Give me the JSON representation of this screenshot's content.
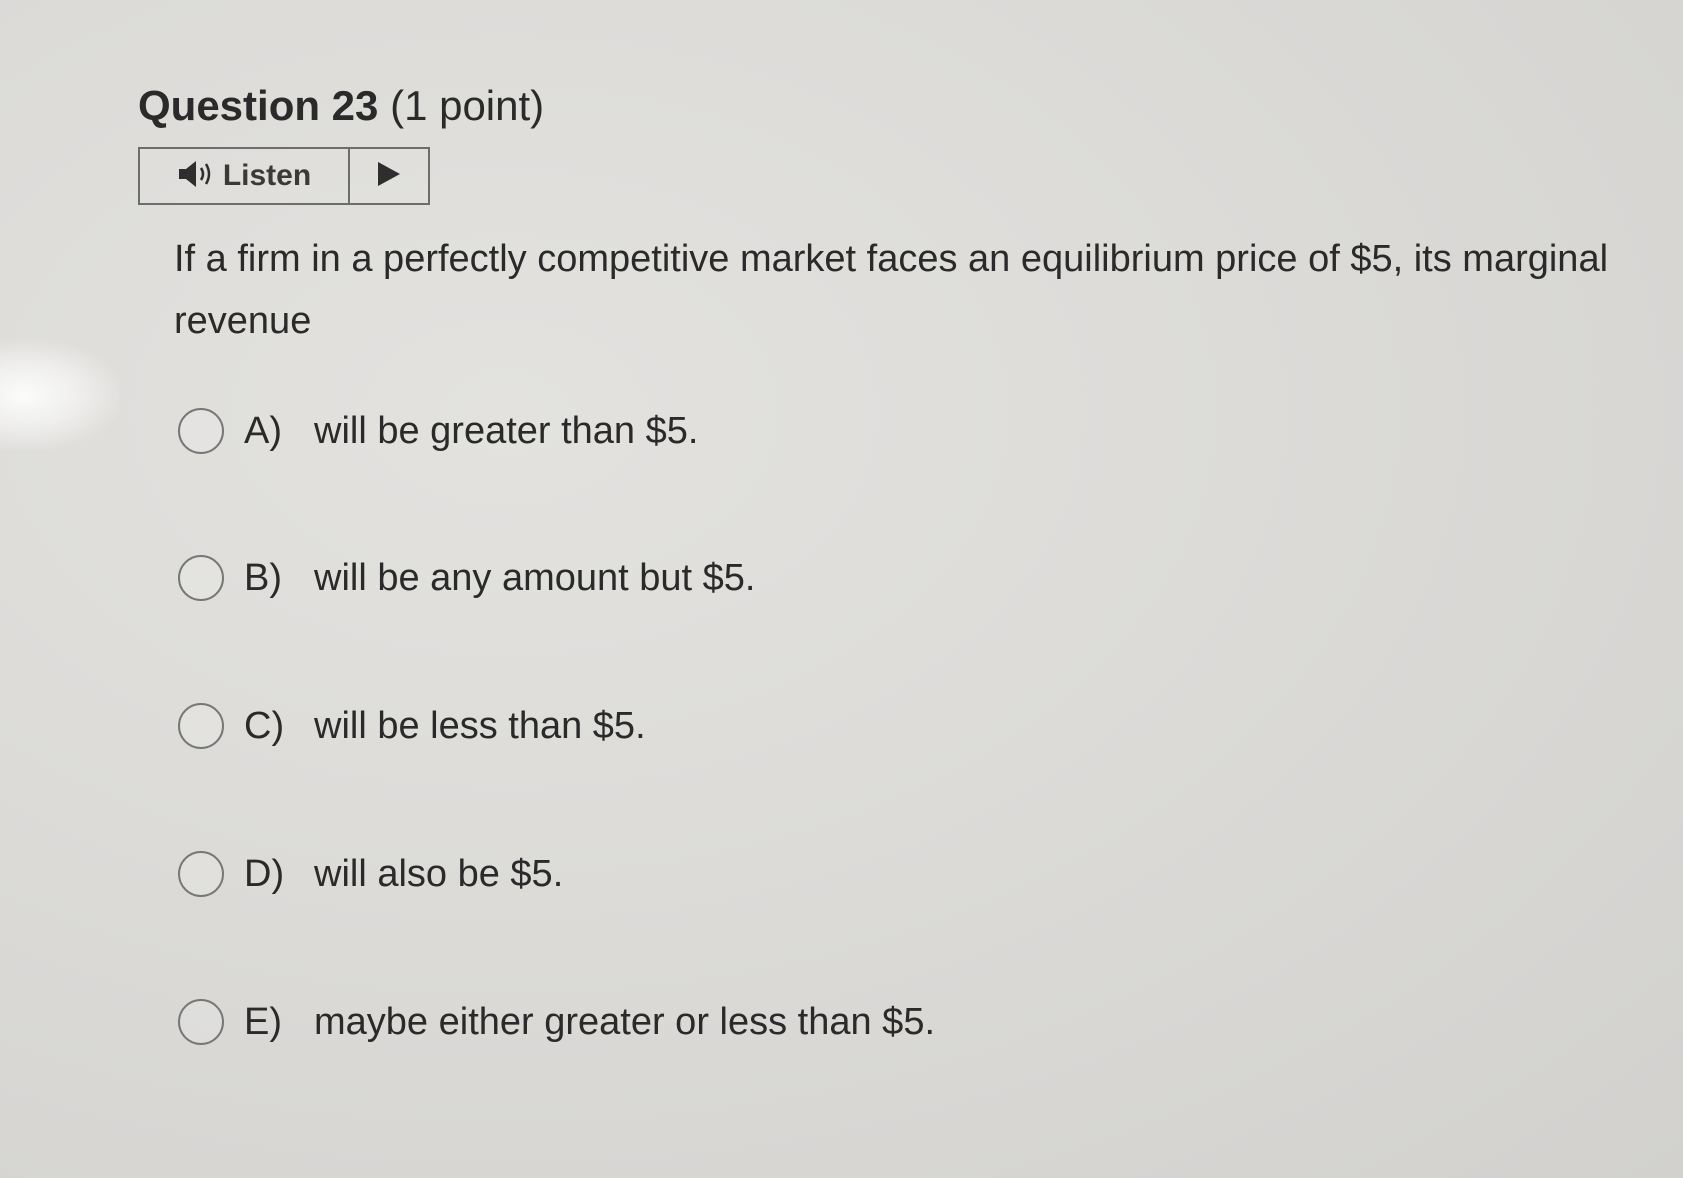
{
  "question": {
    "number_label": "Question 23",
    "points_label": "(1 point)",
    "text": "If a firm in a perfectly competitive market faces an equilibrium price of $5, its marginal revenue"
  },
  "listen": {
    "label": "Listen",
    "speaker_icon": "speaker-icon",
    "play_icon": "play-icon"
  },
  "options": [
    {
      "letter": "A)",
      "text": "will be greater than $5."
    },
    {
      "letter": "B)",
      "text": "will be any amount but $5."
    },
    {
      "letter": "C)",
      "text": "will be less than $5."
    },
    {
      "letter": "D)",
      "text": "will also be $5."
    },
    {
      "letter": "E)",
      "text": "maybe either greater or less than $5."
    }
  ]
}
